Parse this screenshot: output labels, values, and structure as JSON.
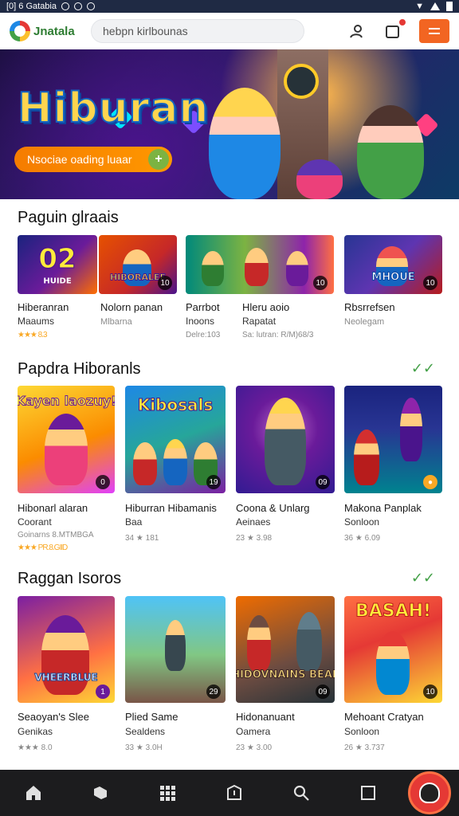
{
  "status_bar": {
    "left_text": "[0] 6 Gatabia"
  },
  "header": {
    "app_name": "Jnatala",
    "search_placeholder": "hebpn kirlbounas"
  },
  "hero": {
    "title": "Hiburan",
    "cta_label": "Nsociae oading luaar"
  },
  "sections": [
    {
      "title": "Paguin glraais",
      "has_check": false,
      "cards": [
        {
          "title": "Hiberanran",
          "subtitle": "Maaums",
          "meta": "★★★ 8.3",
          "badge": ""
        },
        {
          "title": "Nolorn panan",
          "subtitle": "Mlbarna",
          "meta": "",
          "badge": "10"
        },
        {
          "title": "Parrbot",
          "subtitle": "Inoons",
          "meta": "Delre:103",
          "badge": ""
        },
        {
          "title": "Hleru aoio",
          "subtitle": "Rapatat",
          "meta": "Sa: lutran: R/M)68/3",
          "badge": ""
        },
        {
          "title": "Rbsrrefsen",
          "subtitle": "Neolegam",
          "meta": "",
          "badge": ""
        }
      ]
    },
    {
      "title": "Papdra Hiboranls",
      "has_check": true,
      "cards": [
        {
          "title": "Hibonarl alaran",
          "subtitle": "Coorant",
          "meta": "Goinarns 8.MTMBGA",
          "meta2": "★★★ PR.8.GIID",
          "badge": "0"
        },
        {
          "title": "Hiburran Hibamanis",
          "subtitle": "Baa",
          "meta": "34 ★ 181",
          "badge": "19"
        },
        {
          "title": "Coona & Unlarg",
          "subtitle": "Aeinaes",
          "meta": "23 ★ 3.98",
          "badge": "09"
        },
        {
          "title": "Makona Panplak",
          "subtitle": "Sonloon",
          "meta": "36 ★ 6.09",
          "badge": ""
        }
      ]
    },
    {
      "title": "Raggan Isoros",
      "has_check": true,
      "cards": [
        {
          "title": "Seaoyan's Slee",
          "subtitle": "Genikas",
          "meta": "★★★ 8.0",
          "badge": ""
        },
        {
          "title": "Plied Same",
          "subtitle": "Sealdens",
          "meta": "33 ★ 3.0H",
          "badge": "29"
        },
        {
          "title": "Hidonanuant",
          "subtitle": "Oamera",
          "meta": "23 ★ 3.00",
          "badge": "09"
        },
        {
          "title": "Mehoant Cratyan",
          "subtitle": "Sonloon",
          "meta": "26 ★ 3.737",
          "badge": ""
        }
      ]
    }
  ],
  "thumb_art": {
    "s1c1": "02",
    "s1c1_sub": "HUIDE",
    "s1c2": "HIBORALEE",
    "s1c4": "MHOUE",
    "s2c1": "Kayen laozuy!",
    "s2c2": "Kibosals",
    "s3c1": "VHEERBLUE",
    "s3c3": "HIDOVNAINS BEAE",
    "s3c4": "BASAH!"
  },
  "colors": {
    "accent": "#f26522",
    "nav_bg": "#1c1c1e",
    "check": "#43a047",
    "star": "#f9a825"
  },
  "icons": {
    "bottom_nav": [
      "home-icon",
      "tag-icon",
      "grid-icon",
      "shield-icon",
      "search-icon",
      "square-icon",
      "avatar-icon"
    ]
  }
}
